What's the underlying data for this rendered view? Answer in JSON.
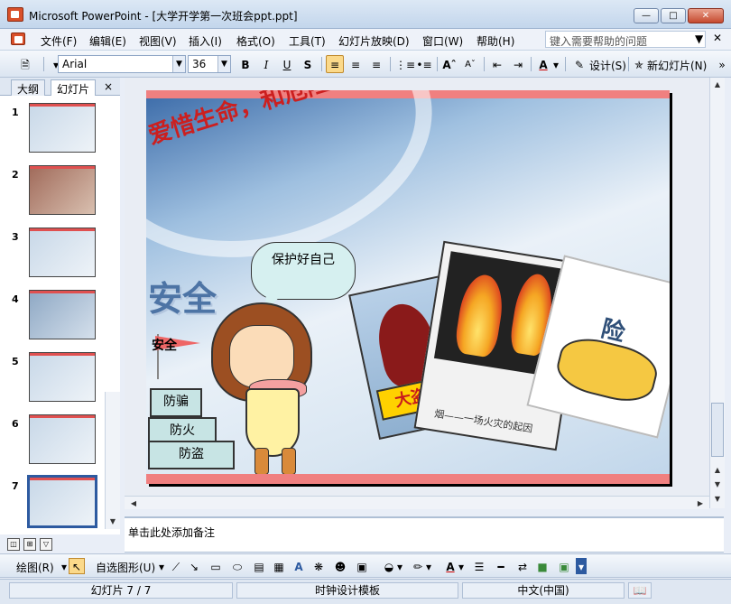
{
  "window": {
    "title": "Microsoft PowerPoint - [大学开学第一次班会ppt.ppt]"
  },
  "menu": {
    "items": [
      "文件(F)",
      "编辑(E)",
      "视图(V)",
      "插入(I)",
      "格式(O)",
      "工具(T)",
      "幻灯片放映(D)",
      "窗口(W)",
      "帮助(H)"
    ],
    "help_placeholder": "键入需要帮助的问题"
  },
  "toolbar": {
    "font_name": "Arial",
    "font_size": "36",
    "bold": "B",
    "italic": "I",
    "underline": "U",
    "shadow": "S",
    "design_label": "设计(S)",
    "new_slide_label": "新幻灯片(N)"
  },
  "panel": {
    "tabs": [
      "大纲",
      "幻灯片"
    ],
    "close": "×",
    "slide_numbers": [
      "1",
      "2",
      "3",
      "4",
      "5",
      "6",
      "7"
    ],
    "selected_slide": 7
  },
  "slide": {
    "headline": "爱惜生命，和危险说拜拜！！！",
    "bubble": "保护好自己",
    "anquan_big": "安全",
    "anquan_small": "安全",
    "boxes": [
      "防骗",
      "防火",
      "防盗"
    ],
    "poster1_banner": "大盗贼",
    "poster2_caption": "烟——一场火灾的起因",
    "poster3_label": "险"
  },
  "notes": {
    "placeholder": "单击此处添加备注"
  },
  "drawing": {
    "draw_label": "绘图(R)",
    "autoshape_label": "自选图形(U)"
  },
  "status": {
    "slide_info": "幻灯片 7 / 7",
    "template": "时钟设计模板",
    "language": "中文(中国)"
  },
  "colors": {
    "accent": "#cc1f1f",
    "selection": "#2d5aa0",
    "slide_bar": "#f08080"
  }
}
